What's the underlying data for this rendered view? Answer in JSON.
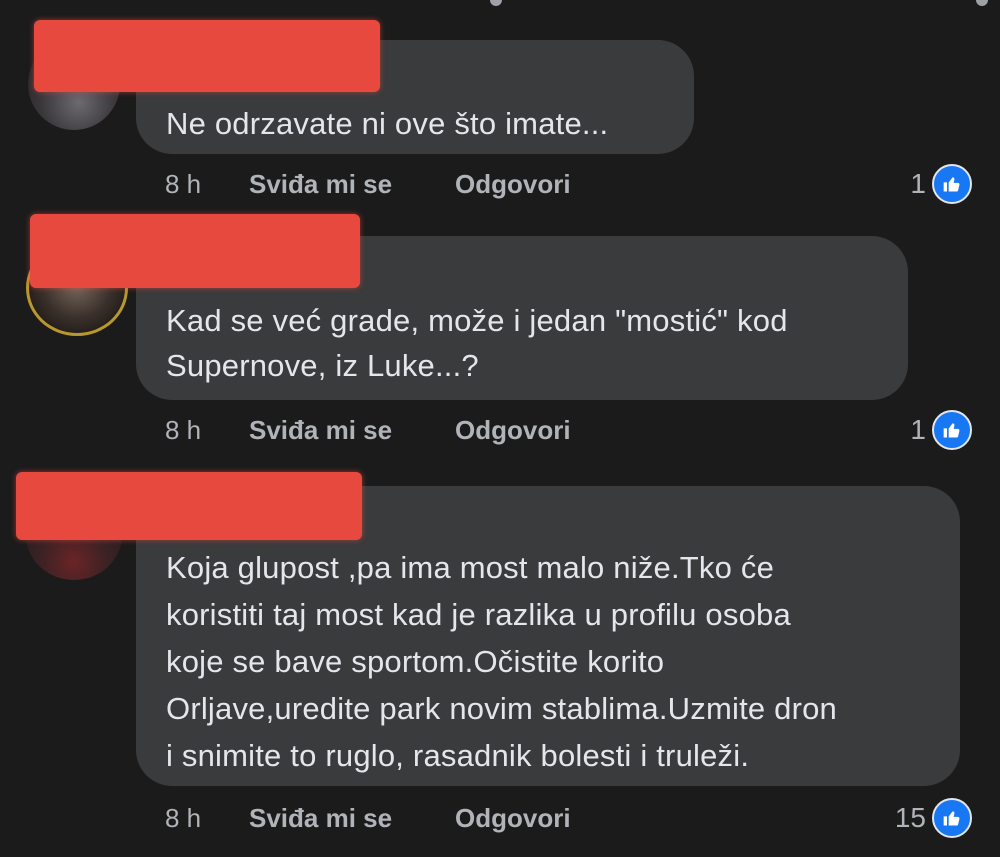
{
  "comments": [
    {
      "text_lines": [
        "Ne odrzavate ni ove što imate..."
      ],
      "time": "8 h",
      "like_label": "Sviđa mi se",
      "reply_label": "Odgovori",
      "reaction_count": "1",
      "reaction_icon": "thumbs-up-icon"
    },
    {
      "text_lines": [
        "Kad se već grade, može i jedan \"mostić\" kod",
        "Supernove, iz Luke...?"
      ],
      "time": "8 h",
      "like_label": "Sviđa mi se",
      "reply_label": "Odgovori",
      "reaction_count": "1",
      "reaction_icon": "thumbs-up-icon"
    },
    {
      "text_lines": [
        "Koja glupost ,pa ima most malo niže.Tko će",
        "koristiti taj most kad je razlika u profilu osoba",
        "koje se bave sportom.Očistite korito",
        "Orljave,uredite park novim stablima.Uzmite dron",
        "i snimite to ruglo, rasadnik bolesti i truleži."
      ],
      "time": "8 h",
      "like_label": "Sviđa mi se",
      "reply_label": "Odgovori",
      "reaction_count": "15",
      "reaction_icon": "thumbs-up-icon"
    }
  ],
  "colors": {
    "background": "#1b1b1c",
    "bubble": "#3a3b3c",
    "text": "#e4e6eb",
    "meta": "#b0b3b8",
    "like_blue": "#1877f2",
    "redaction": "#e8493f"
  }
}
